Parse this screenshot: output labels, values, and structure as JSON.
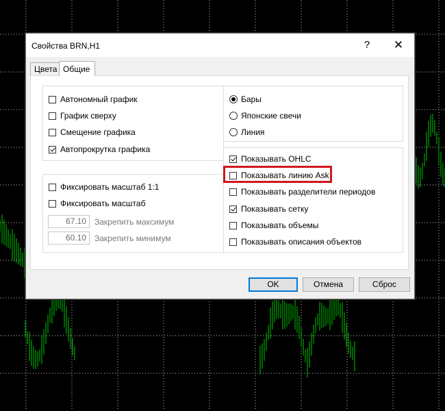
{
  "dialog": {
    "title": "Свойства BRN,H1",
    "help_symbol": "?",
    "close_symbol": "✕"
  },
  "tabs": [
    {
      "label": "Цвета",
      "active": false
    },
    {
      "label": "Общие",
      "active": true
    }
  ],
  "left_options": [
    {
      "label": "Автономный график",
      "checked": false
    },
    {
      "label": "График сверху",
      "checked": false
    },
    {
      "label": "Смещение графика",
      "checked": false
    },
    {
      "label": "Автопрокрутка графика",
      "checked": true
    }
  ],
  "scale": {
    "fix_scale_1_1": {
      "label": "Фиксировать масштаб 1:1",
      "checked": false
    },
    "fix_scale": {
      "label": "Фиксировать масштаб",
      "checked": false
    },
    "max": {
      "value": "67.10",
      "label": "Закрепить максимум"
    },
    "min": {
      "value": "60.10",
      "label": "Закрепить минимум"
    }
  },
  "chart_type": [
    {
      "label": "Бары",
      "selected": true
    },
    {
      "label": "Японские свечи",
      "selected": false
    },
    {
      "label": "Линия",
      "selected": false
    }
  ],
  "show_options": [
    {
      "label": "Показывать OHLC",
      "checked": true
    },
    {
      "label": "Показывать линию Ask",
      "checked": false
    },
    {
      "label": "Показывать разделители периодов",
      "checked": false
    },
    {
      "label": "Показывать сетку",
      "checked": true
    },
    {
      "label": "Показывать объемы",
      "checked": false
    },
    {
      "label": "Показывать описания объектов",
      "checked": false
    }
  ],
  "buttons": {
    "ok": "OK",
    "cancel": "Отмена",
    "reset": "Сброс"
  },
  "colors": {
    "chart_bg": "#000000",
    "grid": "#c8c8c8",
    "bars": "#00c800",
    "highlight": "#d1161c",
    "default_button_border": "#0078d7"
  }
}
